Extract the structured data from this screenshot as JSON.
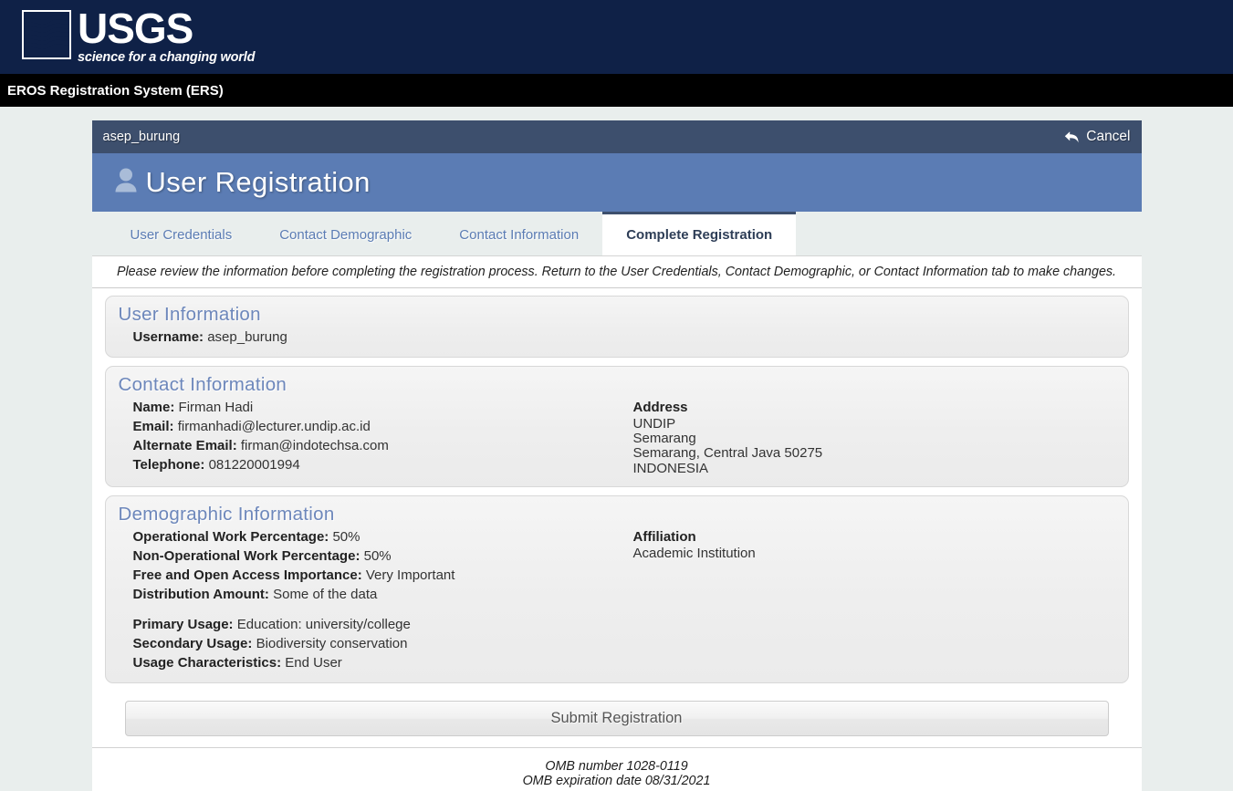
{
  "banner": {
    "wordmark": "USGS",
    "tagline": "science for a changing world",
    "logo_icon": "usgs-wave-logo"
  },
  "app_bar": {
    "title": "EROS Registration System (ERS)"
  },
  "userbar": {
    "username": "asep_burung",
    "cancel_label": "Cancel",
    "cancel_icon": "undo-arrow-icon"
  },
  "header": {
    "title": "User Registration",
    "icon": "user-icon",
    "background_color": "#5b7cb4"
  },
  "tabs": [
    {
      "label": "User Credentials",
      "active": false
    },
    {
      "label": "Contact Demographic",
      "active": false
    },
    {
      "label": "Contact Information",
      "active": false
    },
    {
      "label": "Complete Registration",
      "active": true
    }
  ],
  "instruction": "Please review the information before completing the registration process. Return to the User Credentials, Contact Demographic, or Contact Information tab to make changes.",
  "panels": {
    "user_information": {
      "heading": "User Information",
      "username_label": "Username:",
      "username_value": "asep_burung"
    },
    "contact_information": {
      "heading": "Contact Information",
      "name_label": "Name:",
      "name_value": "Firman Hadi",
      "email_label": "Email:",
      "email_value": "firmanhadi@lecturer.undip.ac.id",
      "alternate_email_label": "Alternate Email:",
      "alternate_email_value": "firman@indotechsa.com",
      "telephone_label": "Telephone:",
      "telephone_value": "081220001994",
      "address_title": "Address",
      "address_lines": [
        "UNDIP",
        "Semarang",
        "Semarang, Central Java 50275",
        "INDONESIA"
      ]
    },
    "demographic_information": {
      "heading": "Demographic Information",
      "operational_label": "Operational Work Percentage:",
      "operational_value": "50%",
      "non_operational_label": "Non-Operational Work Percentage:",
      "non_operational_value": "50%",
      "free_open_label": "Free and Open Access Importance:",
      "free_open_value": "Very Important",
      "distribution_label": "Distribution Amount:",
      "distribution_value": "Some of the data",
      "primary_usage_label": "Primary Usage:",
      "primary_usage_value": "Education: university/college",
      "secondary_usage_label": "Secondary Usage:",
      "secondary_usage_value": "Biodiversity conservation",
      "usage_characteristics_label": "Usage Characteristics:",
      "usage_characteristics_value": "End User",
      "affiliation_title": "Affiliation",
      "affiliation_value": "Academic Institution"
    }
  },
  "submit": {
    "label": "Submit Registration"
  },
  "footer": {
    "omb_number": "OMB number 1028-0119",
    "omb_expiration": "OMB expiration date 08/31/2021"
  },
  "colors": {
    "usgs_navy": "#0f2147",
    "app_bar_black": "#000000",
    "userbar_slate": "#3d4f6d",
    "header_blue": "#5b7cb4",
    "page_bg": "#e9eeed",
    "panel_heading": "#6d87bb"
  }
}
